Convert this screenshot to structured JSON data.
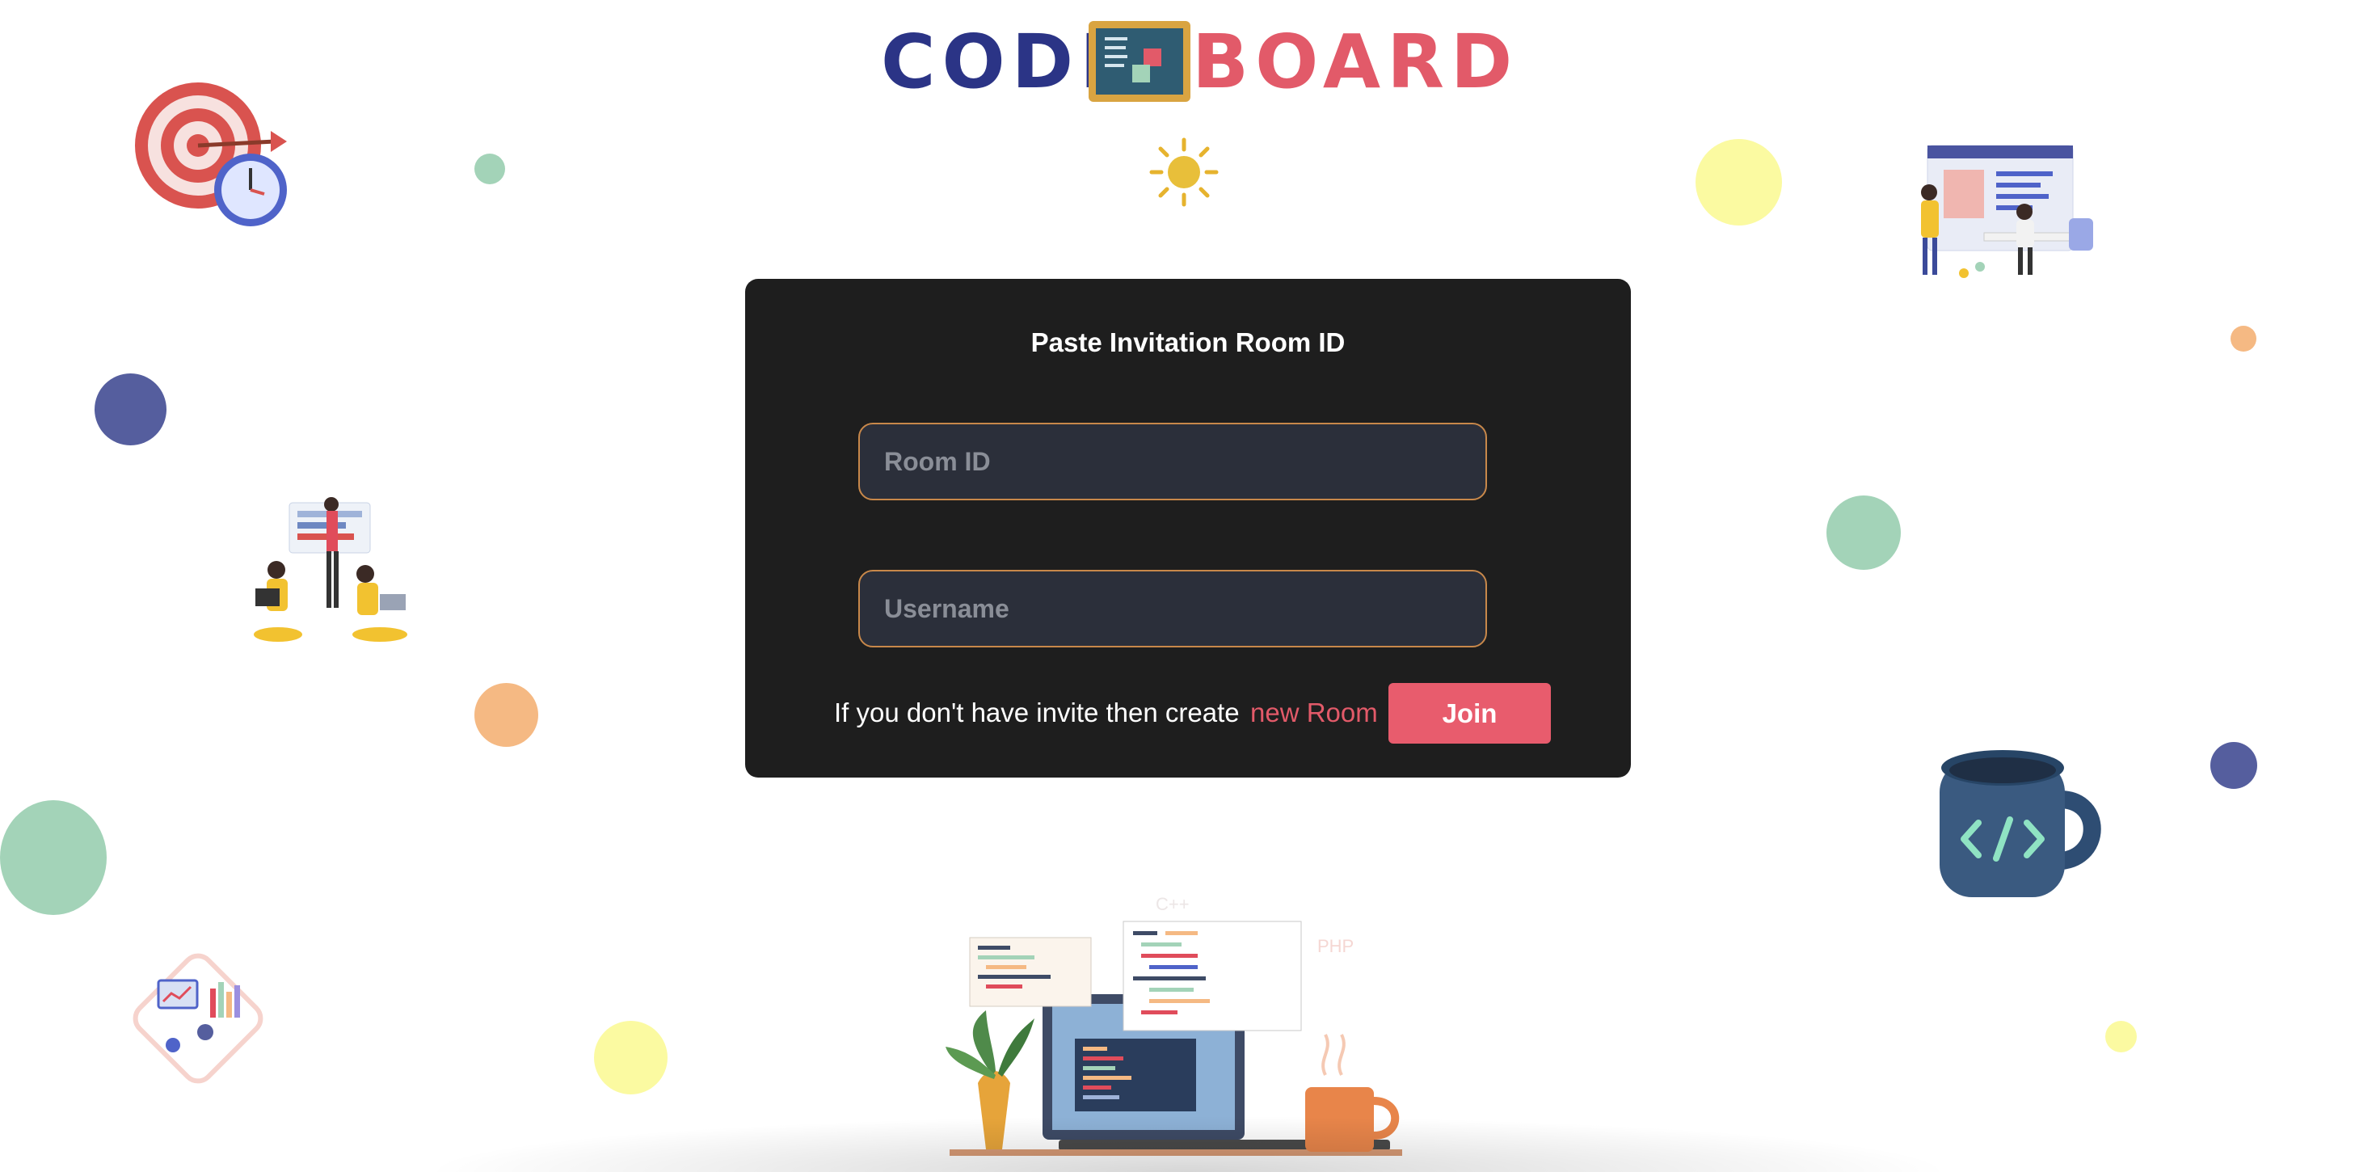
{
  "logo": {
    "part1": "CODE",
    "part2": "BOARD"
  },
  "card": {
    "title": "Paste Invitation Room ID",
    "room_id_placeholder": "Room ID",
    "room_id_value": "",
    "username_placeholder": "Username",
    "username_value": "",
    "hint_text": "If you don't have invite then create",
    "new_room_label": "new Room",
    "join_label": "Join"
  },
  "colors": {
    "brand_blue": "#2b3486",
    "brand_red": "#e25a69",
    "card_bg": "#1e1e1e",
    "input_border": "#c8884a",
    "join_button": "#e85c6d"
  },
  "icons": [
    "target-clock-icon",
    "sun-icon",
    "team-coding-illustration",
    "collaboration-illustration",
    "analytics-illustration",
    "coffee-mug-code-icon",
    "laptop-code-illustration"
  ],
  "illustration_text": {
    "lang_cpp": "C++",
    "lang_php": "PHP"
  }
}
